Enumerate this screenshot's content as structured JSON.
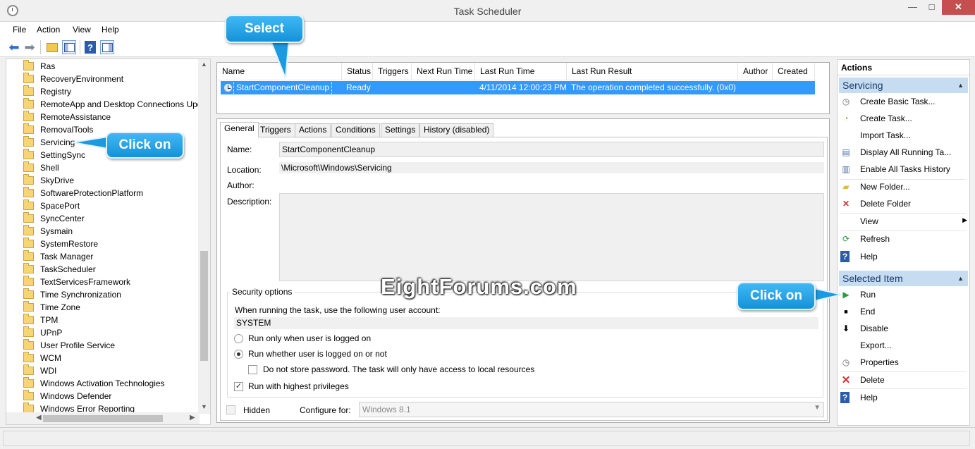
{
  "window": {
    "title": "Task Scheduler",
    "minimize": "—",
    "maximize": "□",
    "close": "✕"
  },
  "menu": [
    "File",
    "Action",
    "View",
    "Help"
  ],
  "toolbar": {
    "help": "?"
  },
  "tree": {
    "items": [
      "Ras",
      "RecoveryEnvironment",
      "Registry",
      "RemoteApp and Desktop Connections Upd",
      "RemoteAssistance",
      "RemovalTools",
      "Servicing",
      "SettingSync",
      "Shell",
      "SkyDrive",
      "SoftwareProtectionPlatform",
      "SpacePort",
      "SyncCenter",
      "Sysmain",
      "SystemRestore",
      "Task Manager",
      "TaskScheduler",
      "TextServicesFramework",
      "Time Synchronization",
      "Time Zone",
      "TPM",
      "UPnP",
      "User Profile Service",
      "WCM",
      "WDI",
      "Windows Activation Technologies",
      "Windows Defender",
      "Windows Error Reporting"
    ]
  },
  "tasklist": {
    "columns": [
      "Name",
      "Status",
      "Triggers",
      "Next Run Time",
      "Last Run Time",
      "Last Run Result",
      "Author",
      "Created"
    ],
    "row": {
      "name": "StartComponentCleanup",
      "status": "Ready",
      "triggers": "",
      "next_run": "",
      "last_run": "4/11/2014 12:00:23 PM",
      "last_result": "The operation completed successfully. (0x0)",
      "author": "",
      "created": ""
    }
  },
  "details": {
    "tabs": [
      "General",
      "Triggers",
      "Actions",
      "Conditions",
      "Settings",
      "History (disabled)"
    ],
    "name_label": "Name:",
    "name_value": "StartComponentCleanup",
    "location_label": "Location:",
    "location_value": "\\Microsoft\\Windows\\Servicing",
    "author_label": "Author:",
    "description_label": "Description:",
    "security_title": "Security options",
    "account_prompt": "When running the task, use the following user account:",
    "account_value": "SYSTEM",
    "radio_logged_on": "Run only when user is logged on",
    "radio_whether": "Run whether user is logged on or not",
    "no_store_password": "Do not store password.  The task will only have access to local resources",
    "highest_priv": "Run with highest privileges",
    "hidden": "Hidden",
    "configure_for_label": "Configure for:",
    "configure_for_value": "Windows 8.1"
  },
  "actions": {
    "title": "Actions",
    "section1": "Servicing",
    "section1_items": [
      "Create Basic Task...",
      "Create Task...",
      "Import Task...",
      "Display All Running Ta...",
      "Enable All Tasks History",
      "New Folder...",
      "Delete Folder",
      "View",
      "Refresh",
      "Help"
    ],
    "section2": "Selected Item",
    "section2_items": [
      "Run",
      "End",
      "Disable",
      "Export...",
      "Properties",
      "Delete",
      "Help"
    ]
  },
  "callouts": {
    "select": "Select",
    "click_on_1": "Click on",
    "click_on_2": "Click on"
  },
  "watermark": "EightForums.com",
  "colors": {
    "selection": "#3399ff",
    "callout": "#1ea4e6",
    "section_header": "#c6dcf1"
  }
}
